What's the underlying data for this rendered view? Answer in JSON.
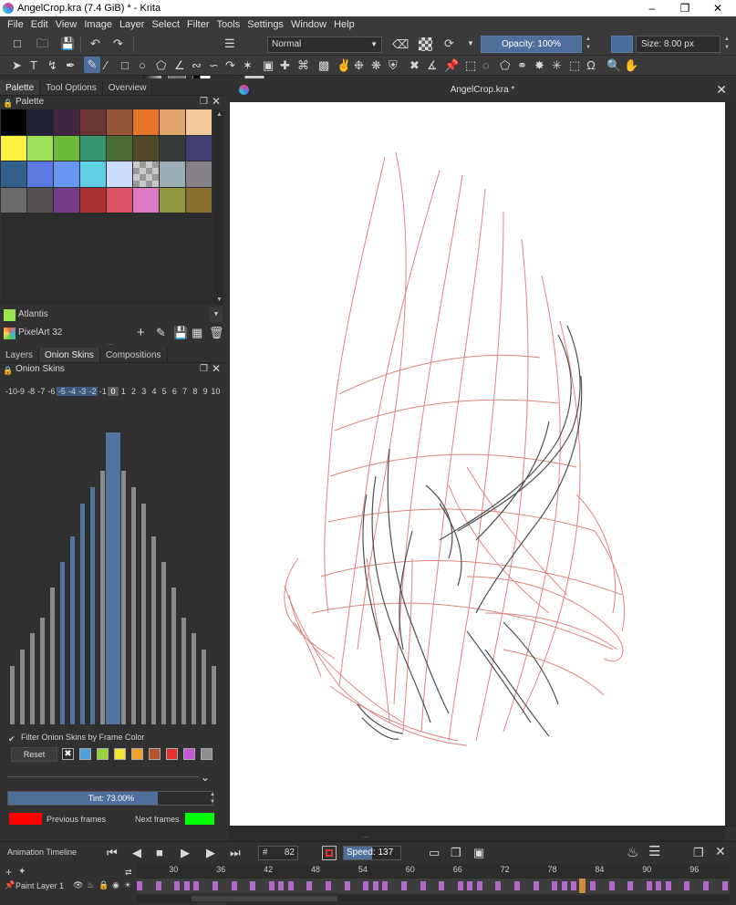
{
  "window": {
    "title": "AngelCrop.kra (7.4 GiB)  * - Krita"
  },
  "menu": [
    "File",
    "Edit",
    "View",
    "Image",
    "Layer",
    "Select",
    "Filter",
    "Tools",
    "Settings",
    "Window",
    "Help"
  ],
  "toolbar": {
    "blend_mode": "Normal",
    "opacity": "Opacity: 100%",
    "size": "Size: 8.00 px",
    "brush_color": "#4a6f9d"
  },
  "left_tabs": [
    "Palette",
    "Tool Options",
    "Overview"
  ],
  "palette": {
    "title": "Palette",
    "colors": [
      "#000000",
      "#1f1f36",
      "#432741",
      "#6b3432",
      "#955638",
      "#e6742a",
      "#e0a36a",
      "#f0c89a",
      "#fef041",
      "#9de05a",
      "#6cba39",
      "#369471",
      "#4a6b31",
      "#4e4a28",
      "#333b3b",
      "#3e3e72",
      "#31608b",
      "#5d78e0",
      "#6698f2",
      "#5fcfe4",
      "#cbdcfa",
      "checker",
      "#9cadb6",
      "#857f87",
      "#6b6b6b",
      "#545050",
      "#763c88",
      "#ac3131",
      "#db5062",
      "#dd78c2",
      "#8f9740",
      "#8b6e31"
    ],
    "selected_name": "Atlantis",
    "selected_color": "#99e550",
    "palette_name": "PixelArt 32"
  },
  "bottom_tabs": [
    "Layers",
    "Onion Skins",
    "Compositions"
  ],
  "onion": {
    "title": "Onion Skins",
    "frames": [
      "-10",
      "-9",
      "-8",
      "-7",
      "-6",
      "-5",
      "-4",
      "-3",
      "-2",
      "-1",
      "0",
      "1",
      "2",
      "3",
      "4",
      "5",
      "6",
      "7",
      "8",
      "9",
      "10"
    ],
    "levels": [
      0.18,
      0.23,
      0.28,
      0.33,
      0.42,
      0.5,
      0.58,
      0.68,
      0.73,
      0.78,
      0.9,
      0.78,
      0.73,
      0.68,
      0.58,
      0.5,
      0.42,
      0.33,
      0.28,
      0.23,
      0.18
    ],
    "filter_label": "Filter Onion Skins by Frame Color",
    "reset": "Reset",
    "frame_colors": [
      "#ffffff",
      "#4fa0dc",
      "#9bd23a",
      "#f2e43a",
      "#f2a22a",
      "#b5522e",
      "#e23232",
      "#c45ad2",
      "#8f8f8f"
    ],
    "tint": "Tint: 73.00%",
    "tint_value": 0.73,
    "previous_frames": "Previous frames",
    "next_frames": "Next frames",
    "prev_color": "#ff0000",
    "next_color": "#00ff00"
  },
  "canvas": {
    "title": "AngelCrop.kra *"
  },
  "timeline": {
    "title": "Animation Timeline",
    "frame": "82",
    "speed": "Speed: 137 %",
    "speed_value": 0.5,
    "ruler": [
      "30",
      "36",
      "42",
      "48",
      "54",
      "60",
      "66",
      "72",
      "78",
      "84",
      "90",
      "96"
    ],
    "layer": "Paint Layer 1"
  }
}
